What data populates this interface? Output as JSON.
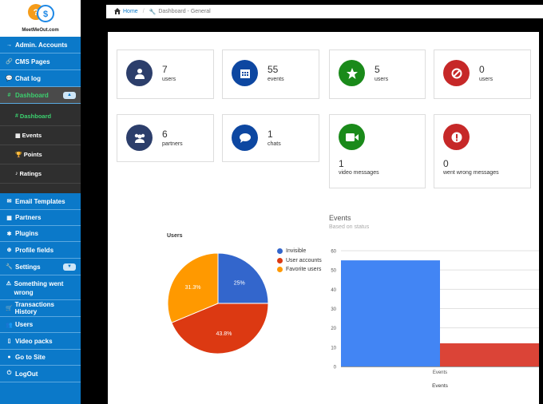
{
  "app": {
    "logo_text": "MeetMeOut.com"
  },
  "breadcrumb": {
    "home": "Home",
    "current": "Dashboard - General"
  },
  "sidebar": {
    "items_top": [
      {
        "icon": "→",
        "label": "Admin. Accounts"
      },
      {
        "icon": "🔗",
        "label": "CMS Pages"
      },
      {
        "icon": "💬",
        "label": "Chat log"
      }
    ],
    "dashboard": {
      "icon": "#",
      "label": "Dashboard",
      "caret": "▲"
    },
    "submenu": [
      {
        "icon": "#",
        "label": "Dashboard"
      },
      {
        "icon": "▦",
        "label": "Events"
      },
      {
        "icon": "🏆",
        "label": "Points"
      },
      {
        "icon": "♪",
        "label": "Ratings"
      }
    ],
    "items_bottom": [
      {
        "icon": "✉",
        "label": "Email Templates"
      },
      {
        "icon": "▦",
        "label": "Partners"
      },
      {
        "icon": "✱",
        "label": "Plugins"
      },
      {
        "icon": "⊕",
        "label": "Profile fields"
      }
    ],
    "settings": {
      "icon": "🔧",
      "label": "Settings",
      "caret": "▼"
    },
    "items_tail": [
      {
        "icon": "⚠",
        "label": "Something went wrong"
      },
      {
        "icon": "🛒",
        "label": "Transactions History"
      },
      {
        "icon": "👥",
        "label": "Users"
      },
      {
        "icon": "▯",
        "label": "Video packs"
      },
      {
        "icon": "●",
        "label": "Go to Site"
      },
      {
        "icon": "⏻",
        "label": "LogOut"
      }
    ]
  },
  "stats": [
    {
      "icon": "user-icon",
      "value": "7",
      "label": "users",
      "color": "#2c3e6b"
    },
    {
      "icon": "calendar-icon",
      "value": "55",
      "label": "events",
      "color": "#0d47a1"
    },
    {
      "icon": "star-icon",
      "value": "5",
      "label": "users",
      "color": "#1a8a1a"
    },
    {
      "icon": "ban-icon",
      "value": "0",
      "label": "users",
      "color": "#c62828"
    },
    {
      "icon": "partners-icon",
      "value": "6",
      "label": "partners",
      "color": "#2c3e6b"
    },
    {
      "icon": "chat-icon",
      "value": "1",
      "label": "chats",
      "color": "#0d47a1"
    },
    {
      "icon": "video-icon",
      "value": "1",
      "label": "video messages",
      "color": "#1a8a1a"
    },
    {
      "icon": "alert-icon",
      "value": "0",
      "label": "went wrong messages",
      "color": "#c62828"
    }
  ],
  "pie": {
    "title": "Users"
  },
  "events_chart": {
    "title": "Events",
    "subtitle": "Based on status",
    "x_title": "Events"
  },
  "chart_data": [
    {
      "type": "pie",
      "title": "Users",
      "labels": [
        "Invisible",
        "User accounts",
        "Favorite users"
      ],
      "values": [
        25,
        43.8,
        31.3
      ],
      "value_labels": [
        "25%",
        "43.8%",
        "31.3%"
      ],
      "colors": [
        "#3366cc",
        "#dc3912",
        "#ff9900"
      ],
      "legend": "right"
    },
    {
      "type": "bar",
      "title": "Events",
      "subtitle": "Based on status",
      "categories": [
        "Events"
      ],
      "xlabel": "Events",
      "series": [
        {
          "values": [
            55
          ],
          "color": "#4285f4"
        },
        {
          "values": [
            12
          ],
          "color": "#db4437"
        }
      ],
      "ylim": [
        0,
        60
      ],
      "yticks": [
        0,
        10,
        20,
        30,
        40,
        50,
        60
      ],
      "grid": true
    }
  ]
}
